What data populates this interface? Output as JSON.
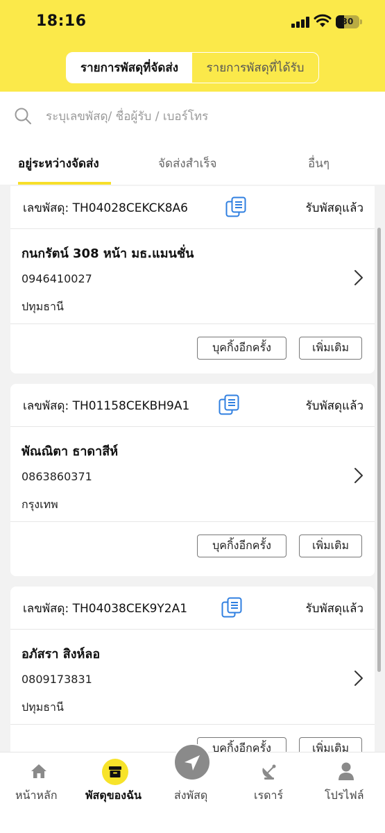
{
  "status_bar": {
    "time": "18:16",
    "battery": "30"
  },
  "segments": {
    "sent": "รายการพัสดุที่จัดส่ง",
    "received": "รายการพัสดุที่ได้รับ"
  },
  "search": {
    "placeholder": "ระบุเลขพัสดุ/ ชื่อผู้รับ / เบอร์โทร",
    "value": ""
  },
  "tabs": [
    {
      "label": "อยู่ระหว่างจัดส่ง"
    },
    {
      "label": "จัดส่งสำเร็จ"
    },
    {
      "label": "อื่นๆ"
    }
  ],
  "parcels": [
    {
      "tracking_label": "เลขพัสดุ: TH04028CEKCK8A6",
      "status": "รับพัสดุแล้ว",
      "recipient": "กนกรัตน์ 308 หน้า มธ.แมนชั่น",
      "phone": "0946410027",
      "province": "ปทุมธานี",
      "rebook_label": "บุคกิ้งอีกครั้ง",
      "more_label": "เพิ่มเติม"
    },
    {
      "tracking_label": "เลขพัสดุ: TH01158CEKBH9A1",
      "status": "รับพัสดุแล้ว",
      "recipient": "พัณณิตา ธาดาสีห์",
      "phone": "0863860371",
      "province": "กรุงเทพ",
      "rebook_label": "บุคกิ้งอีกครั้ง",
      "more_label": "เพิ่มเติม"
    },
    {
      "tracking_label": "เลขพัสดุ: TH04038CEK9Y2A1",
      "status": "รับพัสดุแล้ว",
      "recipient": "อภัสรา สิงห์ลอ",
      "phone": "0809173831",
      "province": "ปทุมธานี",
      "rebook_label": "บุคกิ้งอีกครั้ง",
      "more_label": "เพิ่มเติม"
    }
  ],
  "bottom_nav": [
    {
      "label": "หน้าหลัก",
      "icon": "home-icon"
    },
    {
      "label": "พัสดุของฉัน",
      "icon": "box-icon"
    },
    {
      "label": "ส่งพัสดุ",
      "icon": "send-icon"
    },
    {
      "label": "เรดาร์",
      "icon": "radar-icon"
    },
    {
      "label": "โปรไฟล์",
      "icon": "profile-icon"
    }
  ],
  "colors": {
    "brand_yellow": "#fbe94a",
    "accent_blue": "#2f7fe0"
  }
}
